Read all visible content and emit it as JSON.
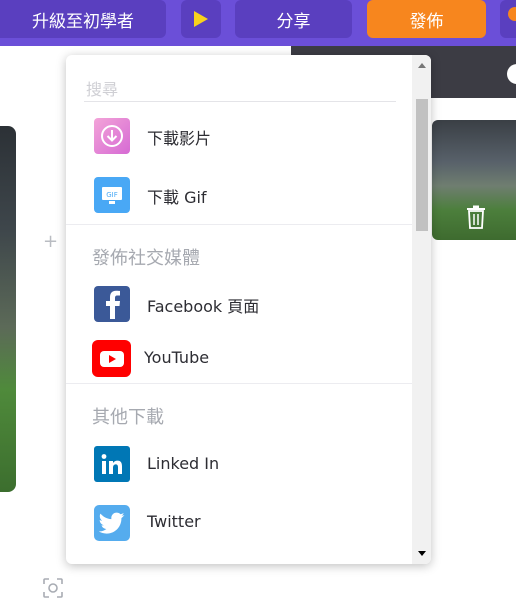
{
  "toolbar": {
    "upgrade_label": "升級至初學者",
    "share_label": "分享",
    "publish_label": "發佈",
    "play_icon": "play-icon"
  },
  "dropdown": {
    "search_placeholder": "搜尋",
    "items_download": [
      {
        "label": "下載影片",
        "icon": "download-video-icon"
      },
      {
        "label": "下載 Gif",
        "icon": "gif-icon"
      }
    ],
    "social_header": "發佈社交媒體",
    "items_social": [
      {
        "label": "Facebook 頁面",
        "icon": "facebook-icon"
      },
      {
        "label": "YouTube",
        "icon": "youtube-icon"
      }
    ],
    "other_header": "其他下載",
    "items_other": [
      {
        "label": "Linked In",
        "icon": "linkedin-icon"
      },
      {
        "label": "Twitter",
        "icon": "twitter-icon"
      }
    ]
  },
  "colors": {
    "topbar": "#6b4fd8",
    "button": "#5a3fbf",
    "publish": "#f7861e",
    "facebook": "#3b5998",
    "youtube": "#ff0000",
    "linkedin": "#0077b5",
    "twitter": "#55acee"
  }
}
